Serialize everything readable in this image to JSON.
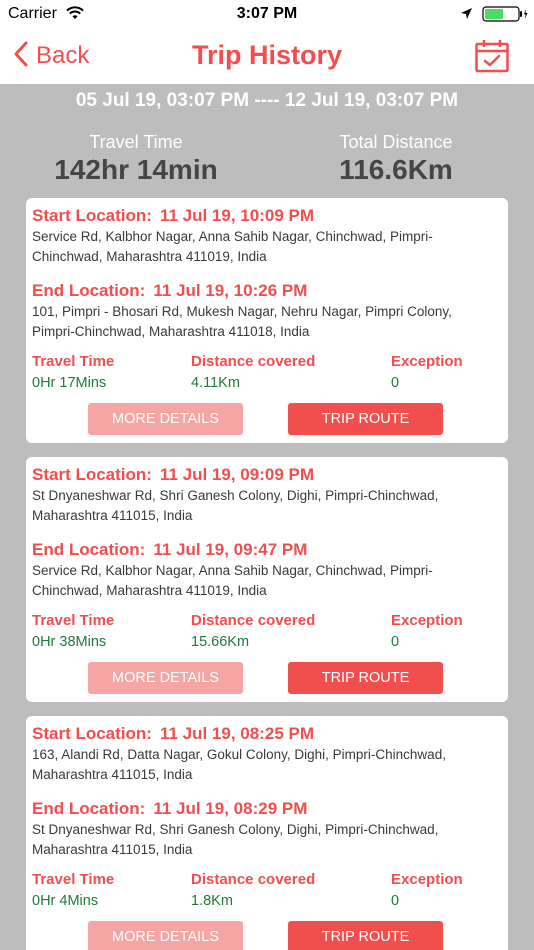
{
  "status_bar": {
    "carrier": "Carrier",
    "time": "3:07 PM"
  },
  "nav": {
    "back_label": "Back",
    "title": "Trip History"
  },
  "summary": {
    "date_range": "05 Jul 19, 03:07 PM ---- 12 Jul 19, 03:07 PM",
    "travel_time_label": "Travel Time",
    "travel_time_value": "142hr 14min",
    "total_distance_label": "Total Distance",
    "total_distance_value": "116.6Km"
  },
  "labels": {
    "start_location": "Start Location:",
    "end_location": "End Location:",
    "travel_time": "Travel Time",
    "distance_covered": "Distance covered",
    "exception": "Exception",
    "more_details": "MORE DETAILS",
    "trip_route": "TRIP ROUTE"
  },
  "trips": [
    {
      "start_time": "11 Jul 19, 10:09 PM",
      "start_address": "Service Rd, Kalbhor Nagar, Anna Sahib Nagar, Chinchwad, Pimpri-Chinchwad, Maharashtra 411019, India",
      "end_time": "11 Jul 19, 10:26 PM",
      "end_address": "101, Pimpri - Bhosari Rd, Mukesh Nagar, Nehru Nagar, Pimpri Colony, Pimpri-Chinchwad, Maharashtra 411018, India",
      "travel_time": "0Hr 17Mins",
      "distance": "4.11Km",
      "exception": "0"
    },
    {
      "start_time": "11 Jul 19, 09:09 PM",
      "start_address": "St Dnyaneshwar Rd, Shri Ganesh Colony, Dighi, Pimpri-Chinchwad, Maharashtra 411015, India",
      "end_time": "11 Jul 19, 09:47 PM",
      "end_address": "Service Rd, Kalbhor Nagar, Anna Sahib Nagar, Chinchwad, Pimpri-Chinchwad, Maharashtra 411019, India",
      "travel_time": "0Hr 38Mins",
      "distance": "15.66Km",
      "exception": "0"
    },
    {
      "start_time": "11 Jul 19, 08:25 PM",
      "start_address": "163, Alandi Rd, Datta Nagar, Gokul Colony, Dighi, Pimpri-Chinchwad, Maharashtra 411015, India",
      "end_time": "11 Jul 19, 08:29 PM",
      "end_address": "St Dnyaneshwar Rd, Shri Ganesh Colony, Dighi, Pimpri-Chinchwad, Maharashtra 411015, India",
      "travel_time": "0Hr 4Mins",
      "distance": "1.8Km",
      "exception": "0"
    }
  ],
  "theme": {
    "accent": "#f14e4e",
    "accent_light": "#f6a5a5",
    "background": "#bdbdbd",
    "value_green": "#1f7a3a"
  },
  "icons": {
    "back": "chevron-left-icon",
    "calendar": "calendar-check-icon",
    "wifi": "wifi-icon",
    "location": "location-arrow-icon",
    "battery": "battery-icon"
  }
}
